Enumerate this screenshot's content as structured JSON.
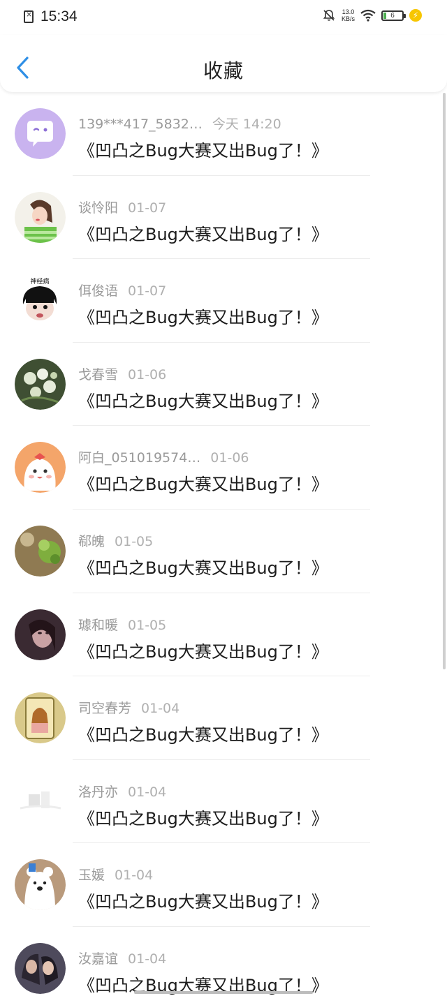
{
  "status_bar": {
    "time": "15:34",
    "net_speed_value": "13.0",
    "net_speed_unit": "KB/s",
    "battery_level": "6"
  },
  "header": {
    "title": "收藏"
  },
  "colors": {
    "accent": "#2f8fe6",
    "meta_text": "#9a9a9a",
    "content_text": "#1c1c1c"
  },
  "items": [
    {
      "name": "139***417_5832…",
      "date": "今天 14:20",
      "content": "《凹凸之Bug大赛又出Bug了！》",
      "avatar_icon": "chat-bubble-avatar"
    },
    {
      "name": "谈怜阳",
      "date": "01-07",
      "content": "《凹凸之Bug大赛又出Bug了！》",
      "avatar_icon": "girl-avatar"
    },
    {
      "name": "佴俊语",
      "date": "01-07",
      "content": "《凹凸之Bug大赛又出Bug了！》",
      "avatar_icon": "cartoon-face-avatar",
      "avatar_text": "神经病"
    },
    {
      "name": "戈春雪",
      "date": "01-06",
      "content": "《凹凸之Bug大赛又出Bug了！》",
      "avatar_icon": "flower-avatar"
    },
    {
      "name": "阿白_051019574…",
      "date": "01-06",
      "content": "《凹凸之Bug大赛又出Bug了！》",
      "avatar_icon": "bunny-avatar"
    },
    {
      "name": "郗魄",
      "date": "01-05",
      "content": "《凹凸之Bug大赛又出Bug了！》",
      "avatar_icon": "plant-avatar"
    },
    {
      "name": "璩和暖",
      "date": "01-05",
      "content": "《凹凸之Bug大赛又出Bug了！》",
      "avatar_icon": "portrait-avatar"
    },
    {
      "name": "司空春芳",
      "date": "01-04",
      "content": "《凹凸之Bug大赛又出Bug了！》",
      "avatar_icon": "illustration-avatar"
    },
    {
      "name": "洛丹亦",
      "date": "01-04",
      "content": "《凹凸之Bug大赛又出Bug了！》",
      "avatar_icon": "faded-avatar"
    },
    {
      "name": "玉媛",
      "date": "01-04",
      "content": "《凹凸之Bug大赛又出Bug了！》",
      "avatar_icon": "bear-avatar"
    },
    {
      "name": "汝嘉谊",
      "date": "01-04",
      "content": "《凹凸之Bug大赛又出Bug了！》",
      "avatar_icon": "couple-avatar"
    }
  ]
}
